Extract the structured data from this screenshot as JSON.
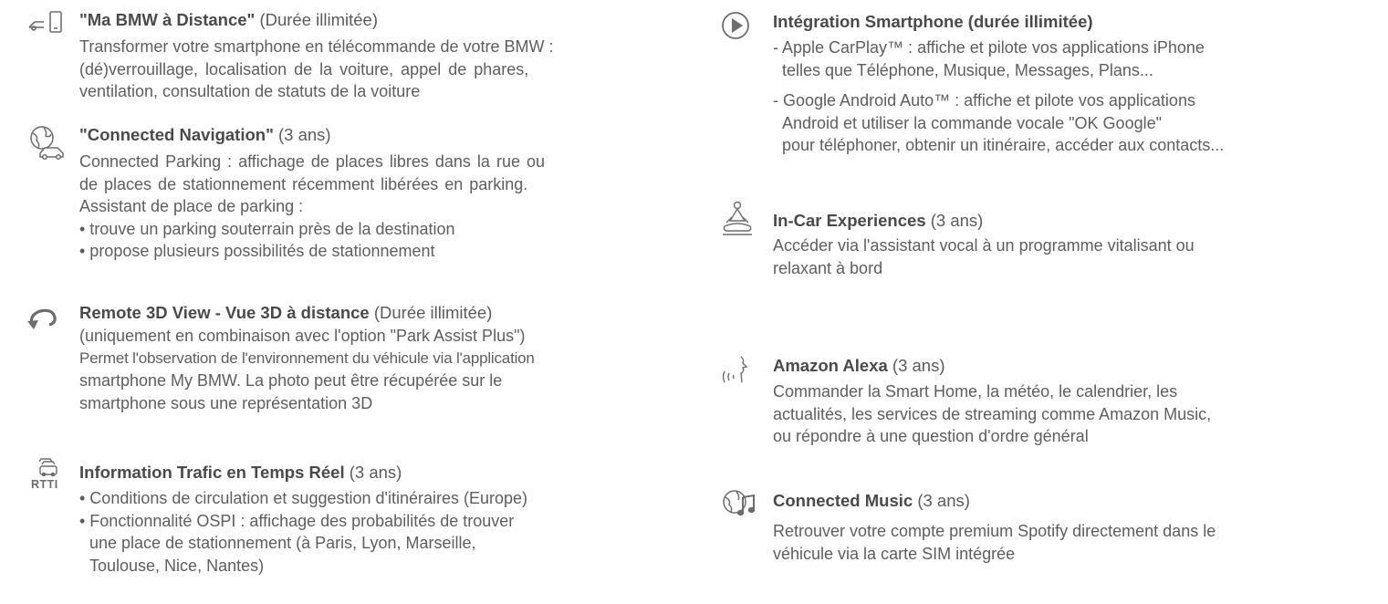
{
  "left_column": {
    "remote": {
      "icon": "phone-car-icon",
      "title": "\"Ma BMW à Distance\"",
      "duration": "(Durée illimitée)",
      "lines": [
        "Transformer votre smartphone en télécommande de votre BMW :",
        "(dé)verrouillage, localisation de la voiture, appel de phares,",
        "ventilation, consultation de statuts de la voiture"
      ]
    },
    "navigation": {
      "icon": "globe-car-icon",
      "title": "\"Connected Navigation\"",
      "duration": "(3 ans)",
      "lines": [
        "Connected Parking : affichage de places libres dans la rue ou",
        "de places de stationnement récemment libérées en parking.",
        "Assistant de place de parking :"
      ],
      "bullets": [
        "• trouve un parking souterrain près de la destination",
        "• propose plusieurs possibilités de stationnement"
      ]
    },
    "view3d": {
      "icon": "rotate-arrow-icon",
      "title": "Remote 3D View - Vue 3D à distance",
      "duration": "(Durée illimitée)",
      "lines": [
        "(uniquement en combinaison avec l'option \"Park Assist Plus\")",
        "Permet l'observation de l'environnement du véhicule via l'application",
        "smartphone My BMW. La photo peut être récupérée sur le",
        "smartphone sous une représentation 3D"
      ]
    },
    "traffic": {
      "icon": "rtti-traffic-icon",
      "icon_label": "RTTI",
      "title": "Information Trafic en Temps Réel",
      "duration": "(3 ans)",
      "bullets": [
        "• Conditions de circulation et suggestion d'itinéraires (Europe)",
        "• Fonctionnalité OSPI : affichage des probabilités de trouver",
        "une place de stationnement (à Paris, Lyon, Marseille,",
        "Toulouse, Nice, Nantes)"
      ]
    }
  },
  "right_column": {
    "smartphone": {
      "icon": "play-circle-icon",
      "title": "Intégration Smartphone (durée illimitée)",
      "items": [
        [
          "- Apple CarPlay™ : affiche et pilote vos applications iPhone",
          "telles que Téléphone, Musique, Messages, Plans..."
        ],
        [
          "- Google Android Auto™ : affiche et pilote vos applications",
          "Android et utiliser la commande vocale \"OK Google\"",
          "pour téléphoner, obtenir un itinéraire, accéder aux contacts..."
        ]
      ]
    },
    "incar": {
      "icon": "meditation-icon",
      "title": "In-Car Experiences",
      "duration": "(3 ans)",
      "lines": [
        "Accéder via l'assistant vocal à un programme vitalisant ou",
        "relaxant à bord"
      ]
    },
    "alexa": {
      "icon": "voice-waves-icon",
      "title": "Amazon Alexa",
      "duration": "(3 ans)",
      "lines": [
        "Commander la Smart Home, la météo, le calendrier, les",
        "actualités, les services de streaming comme Amazon Music,",
        "ou répondre à une question d'ordre général"
      ]
    },
    "music": {
      "icon": "globe-music-icon",
      "title": "Connected Music",
      "duration": "(3 ans)",
      "lines": [
        "Retrouver votre compte premium Spotify directement dans le",
        "véhicule via la carte SIM intégrée"
      ]
    }
  }
}
